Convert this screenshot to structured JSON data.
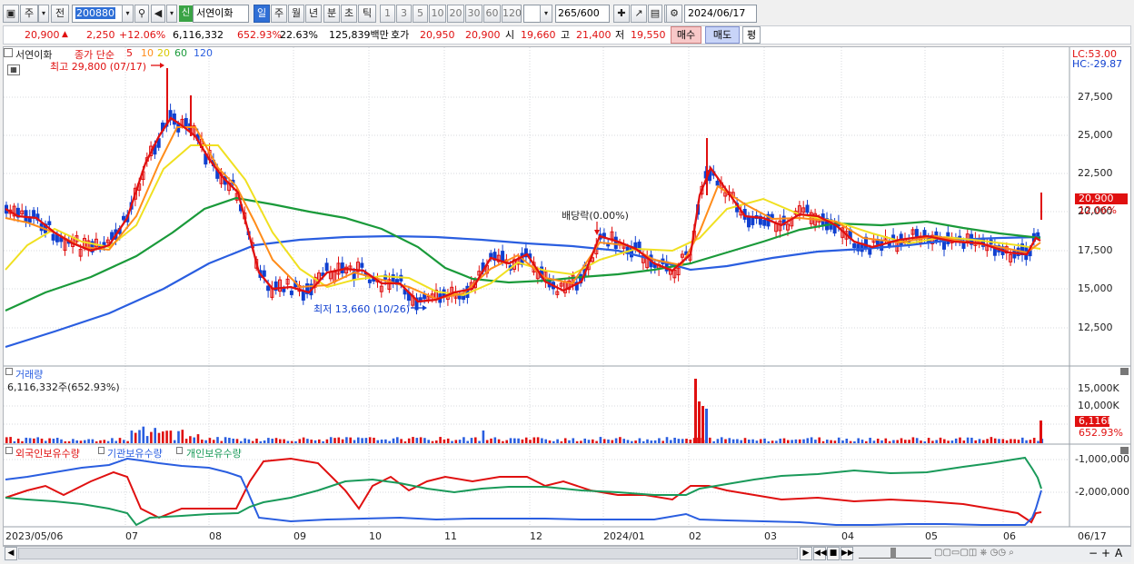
{
  "toolbar": {
    "market": "주",
    "prev": "전",
    "code": "200880",
    "stock_flag": "신",
    "stock_name": "서연이화",
    "periods": [
      "일",
      "주",
      "월",
      "년",
      "분",
      "초",
      "틱"
    ],
    "selected_period": "일",
    "intervals": [
      "1",
      "3",
      "5",
      "10",
      "20",
      "30",
      "60",
      "120"
    ],
    "count": "265",
    "total": "/600",
    "date": "2024/06/17"
  },
  "quote": {
    "price": "20,900",
    "change": "2,250",
    "change_pct": "+12.06%",
    "volume": "6,116,332",
    "vol_ratio": "652.93%",
    "turnover": "22.63%",
    "amount": "125,839백만",
    "hoga_label": "호가",
    "ask": "20,950",
    "bid": "20,900",
    "open_label": "시",
    "open": "19,660",
    "high_label": "고",
    "high": "21,400",
    "low_label": "저",
    "low": "19,550",
    "buy": "매수",
    "sell": "매도",
    "eval": "평"
  },
  "price_panel": {
    "title": "서연이화",
    "ma_label": "종가 단순",
    "ma_periods": [
      "5",
      "10",
      "20",
      "60",
      "120"
    ],
    "ma_colors": [
      "#e01010",
      "#ff8c1a",
      "#f0e020",
      "#1a9a3a",
      "#2a5ee0"
    ],
    "high_note": "최고 29,800 (07/17)",
    "low_note": "최저 13,660 (10/26)",
    "dividend_note": "배당락(0.00%)",
    "lc": "LC:53.00",
    "hc": "HC:-29.87",
    "y_ticks": [
      "27,500",
      "25,000",
      "22,500",
      "20,000",
      "17,500",
      "15,000",
      "12,500"
    ],
    "last_price": "20,900",
    "last_pct": "12.06%"
  },
  "volume_panel": {
    "title": "거래량",
    "info": "6,116,332주(652.93%)",
    "y_ticks": [
      "15,000K",
      "10,000K",
      "5,000K"
    ],
    "last": "6,116K",
    "last_pct": "652.93%"
  },
  "holding_panel": {
    "legend": [
      "외국인보유수량",
      "기관보유수량",
      "개인보유수량"
    ],
    "colors": [
      "#e01010",
      "#2a5ee0",
      "#1a9a5a"
    ],
    "y_ticks": [
      "-1,000,000",
      "-2,000,000"
    ]
  },
  "x_axis": [
    "2023/05/06",
    "07",
    "08",
    "09",
    "10",
    "11",
    "12",
    "2024/01",
    "02",
    "03",
    "04",
    "05",
    "06"
  ],
  "x_axis_right": "06/17"
}
